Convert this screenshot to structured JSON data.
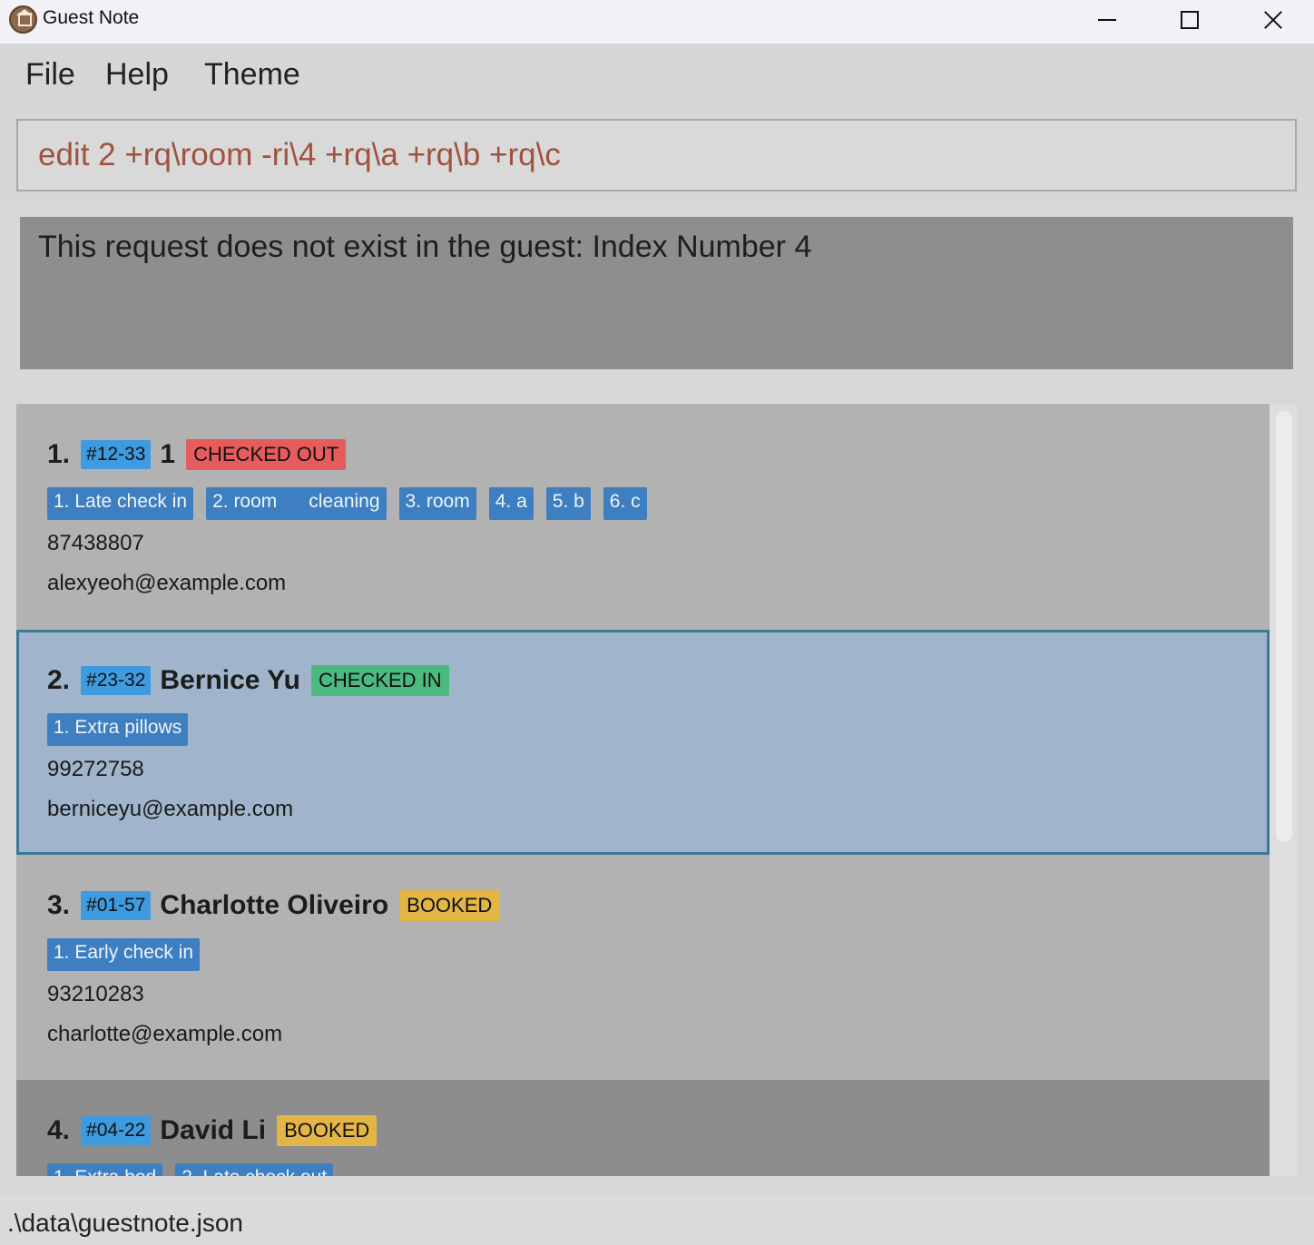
{
  "window": {
    "title": "Guest Note"
  },
  "menu": {
    "items": [
      "File",
      "Help",
      "Theme"
    ]
  },
  "command": {
    "value": "edit 2 +rq\\room -ri\\4 +rq\\a +rq\\b +rq\\c"
  },
  "result": {
    "text": "This request does not exist in the guest: Index Number 4"
  },
  "guests": [
    {
      "index": "1.",
      "room": "#12-33",
      "name": "1",
      "status": "CHECKED OUT",
      "requests": [
        "1. Late check in",
        "2. room      cleaning",
        "3. room",
        "4. a",
        "5. b",
        "6. c"
      ],
      "phone": "87438807",
      "email": "alexyeoh@example.com"
    },
    {
      "index": "2.",
      "room": "#23-32",
      "name": "Bernice Yu",
      "status": "CHECKED IN",
      "requests": [
        "1. Extra pillows"
      ],
      "phone": "99272758",
      "email": "berniceyu@example.com"
    },
    {
      "index": "3.",
      "room": "#01-57",
      "name": "Charlotte Oliveiro",
      "status": "BOOKED",
      "requests": [
        "1. Early check in"
      ],
      "phone": "93210283",
      "email": "charlotte@example.com"
    },
    {
      "index": "4.",
      "room": "#04-22",
      "name": "David Li",
      "status": "BOOKED",
      "requests": [
        "1. Extra bed",
        "2. Late check out"
      ],
      "phone": "",
      "email": ""
    }
  ],
  "statusbar": {
    "path": ".\\data\\guestnote.json"
  },
  "colors": {
    "room_tag": "#3e9be0",
    "request_tag": "#3d7fc1",
    "checked_out": "#e65c5c",
    "checked_in": "#4cba7e",
    "booked": "#e3b547",
    "selected_card": "#a0b5cc",
    "selected_border": "#3b7a95",
    "command_text": "#a0523f"
  },
  "icons": {
    "app": "house-icon",
    "minimize": "minimize-icon",
    "maximize": "maximize-icon",
    "close": "close-icon"
  }
}
